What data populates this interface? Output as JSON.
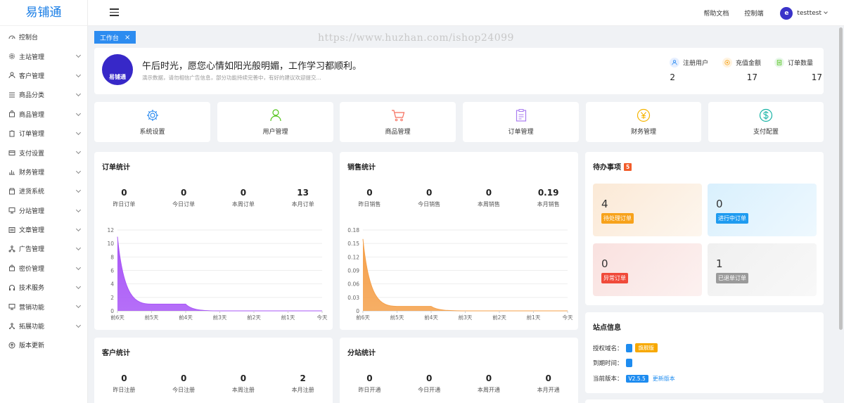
{
  "app": {
    "logo": "易铺通"
  },
  "sidebar": {
    "items": [
      {
        "label": "控制台",
        "icon": "dashboard-icon",
        "expandable": false
      },
      {
        "label": "主站管理",
        "icon": "gear-icon",
        "expandable": true
      },
      {
        "label": "客户管理",
        "icon": "user-icon",
        "expandable": true
      },
      {
        "label": "商品分类",
        "icon": "list-icon",
        "expandable": true
      },
      {
        "label": "商品管理",
        "icon": "bag-icon",
        "expandable": true
      },
      {
        "label": "订单管理",
        "icon": "clipboard-icon",
        "expandable": true
      },
      {
        "label": "支付设置",
        "icon": "wallet-icon",
        "expandable": true
      },
      {
        "label": "财务管理",
        "icon": "bar-chart-icon",
        "expandable": true
      },
      {
        "label": "进货系统",
        "icon": "box-icon",
        "expandable": true
      },
      {
        "label": "分站管理",
        "icon": "monitor-icon",
        "expandable": true
      },
      {
        "label": "文章管理",
        "icon": "document-icon",
        "expandable": true
      },
      {
        "label": "广告管理",
        "icon": "flow-icon",
        "expandable": true
      },
      {
        "label": "密价管理",
        "icon": "lock-bag-icon",
        "expandable": true
      },
      {
        "label": "技术服务",
        "icon": "headset-icon",
        "expandable": true
      },
      {
        "label": "营销功能",
        "icon": "monitor-icon",
        "expandable": true
      },
      {
        "label": "拓展功能",
        "icon": "network-icon",
        "expandable": true
      },
      {
        "label": "版本更新",
        "icon": "upload-icon",
        "expandable": false
      }
    ]
  },
  "topbar": {
    "help": "帮助文档",
    "console": "控制端",
    "username": "testtest"
  },
  "tabs": [
    {
      "label": "工作台",
      "close": "×"
    }
  ],
  "watermark": "https://www.huzhan.com/ishop24099",
  "welcome": {
    "logo_text": "易铺通",
    "greeting": "午后时光，愿您心情如阳光般明媚，工作学习都顺利。",
    "subtext": "演示数据，请勿相信广告信息，部分功能持续完善中，有好的建议欢迎提交...",
    "stats": [
      {
        "label": "注册用户",
        "value": "2",
        "icon": "user-icon",
        "color": "#e6efff"
      },
      {
        "label": "充值金额",
        "value": "17",
        "icon": "coin-icon",
        "color": "#fff3e0"
      },
      {
        "label": "订单数量",
        "value": "17",
        "icon": "list-icon",
        "color": "#e8f7ea"
      }
    ]
  },
  "shortcuts": [
    {
      "label": "系统设置",
      "icon": "gear-icon",
      "color": "#2d8cf0"
    },
    {
      "label": "用户管理",
      "icon": "user-icon",
      "color": "#52c41a"
    },
    {
      "label": "商品管理",
      "icon": "cart-icon",
      "color": "#f56c5b"
    },
    {
      "label": "订单管理",
      "icon": "clipboard-icon",
      "color": "#a97cf0"
    },
    {
      "label": "财务管理",
      "icon": "yen-icon",
      "color": "#f5b400"
    },
    {
      "label": "支付配置",
      "icon": "dollar-icon",
      "color": "#18b3a5"
    }
  ],
  "order_stats": {
    "title": "订单统计",
    "items": [
      {
        "value": "0",
        "label": "昨日订单"
      },
      {
        "value": "0",
        "label": "今日订单"
      },
      {
        "value": "0",
        "label": "本周订单"
      },
      {
        "value": "13",
        "label": "本月订单"
      }
    ]
  },
  "sales_stats": {
    "title": "销售统计",
    "items": [
      {
        "value": "0",
        "label": "昨日销售"
      },
      {
        "value": "0",
        "label": "今日销售"
      },
      {
        "value": "0",
        "label": "本周销售"
      },
      {
        "value": "0.19",
        "label": "本月销售"
      }
    ]
  },
  "customer_stats": {
    "title": "客户统计",
    "items": [
      {
        "value": "0",
        "label": "昨日注册"
      },
      {
        "value": "0",
        "label": "今日注册"
      },
      {
        "value": "0",
        "label": "本周注册"
      },
      {
        "value": "2",
        "label": "本月注册"
      }
    ]
  },
  "branch_stats": {
    "title": "分站统计",
    "items": [
      {
        "value": "0",
        "label": "昨日开通"
      },
      {
        "value": "0",
        "label": "今日开通"
      },
      {
        "value": "0",
        "label": "本周开通"
      },
      {
        "value": "0",
        "label": "本月开通"
      }
    ]
  },
  "todo": {
    "title": "待办事项",
    "badge": "5",
    "items": [
      {
        "value": "4",
        "label": "待处理订单",
        "tag_color": "#f7a21b",
        "bg": "#fdf1e4"
      },
      {
        "value": "0",
        "label": "进行中订单",
        "tag_color": "#1e9bf0",
        "bg": "#e6f5fd"
      },
      {
        "value": "0",
        "label": "异常订单",
        "tag_color": "#f04a3a",
        "bg": "#fbe9e8"
      },
      {
        "value": "1",
        "label": "已退单订单",
        "tag_color": "#9a9a9a",
        "bg": "#f5f5f5"
      }
    ]
  },
  "site_info": {
    "title": "站点信息",
    "auth_domain_label": "授权域名：",
    "auth_tag": "旗舰版",
    "expire_label": "到期时间：",
    "version_label": "当前版本：",
    "version": "V2.5.5",
    "update_link": "更新版本"
  },
  "chart_data": [
    {
      "type": "area",
      "categories": [
        "前6天",
        "前5天",
        "前4天",
        "前3天",
        "前2天",
        "前1天",
        "今天"
      ],
      "values": [
        11,
        1,
        1,
        0,
        0,
        0,
        0
      ],
      "ylim": [
        0,
        12
      ],
      "yticks": [
        0,
        2,
        4,
        6,
        8,
        10,
        12
      ],
      "color": "#a855f7",
      "smooth": true
    },
    {
      "type": "area",
      "categories": [
        "前6天",
        "前5天",
        "前4天",
        "前3天",
        "前2天",
        "前1天",
        "今天"
      ],
      "values": [
        0.16,
        0.01,
        0.01,
        0,
        0,
        0,
        0
      ],
      "ylim": [
        0,
        0.18
      ],
      "yticks": [
        "0",
        "0.03",
        "0.06",
        "0.09",
        "0.12",
        "0.15",
        "0.18"
      ],
      "color": "#f5a04a",
      "smooth": true
    }
  ]
}
